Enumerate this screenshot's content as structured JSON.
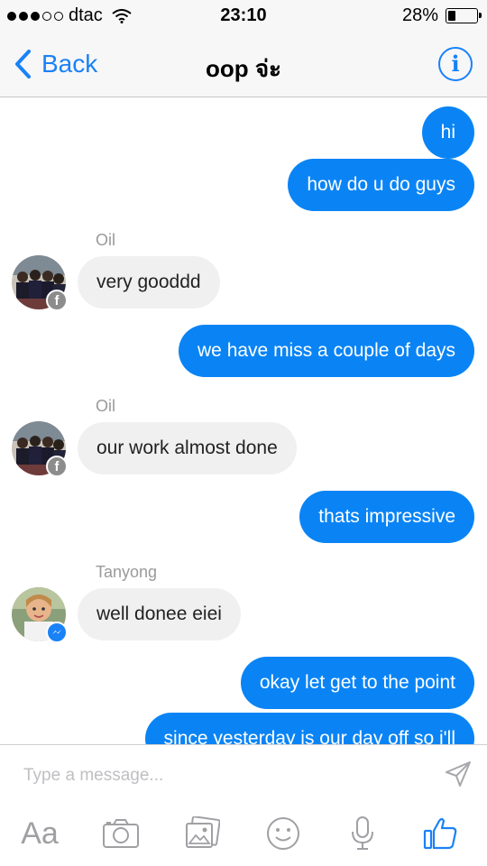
{
  "status_bar": {
    "carrier": "dtac",
    "time": "23:10",
    "battery_percent": "28%",
    "battery_level": 0.28,
    "signal_bars": 3,
    "signal_total": 5
  },
  "nav": {
    "back_label": "Back",
    "title": "oop จ่ะ",
    "info_icon": "info-icon"
  },
  "messages": [
    {
      "side": "out",
      "text": "hi"
    },
    {
      "side": "out",
      "text": "how do u do guys"
    },
    {
      "side": "in",
      "sender": "Oil",
      "text": "very gooddd",
      "badge": "facebook"
    },
    {
      "side": "out",
      "text": "we have miss a couple of days"
    },
    {
      "side": "in",
      "sender": "Oil",
      "text": "our work almost done",
      "badge": "facebook"
    },
    {
      "side": "out",
      "text": "thats impressive"
    },
    {
      "side": "in",
      "sender": "Tanyong",
      "text": "well donee eiei",
      "badge": "messenger"
    },
    {
      "side": "out",
      "text": "okay let get to the point"
    },
    {
      "side": "out",
      "text": "since yesterday is our day off so i'll"
    }
  ],
  "compose": {
    "placeholder": "Type a message...",
    "toolbar": [
      "text-format-icon",
      "camera-icon",
      "photo-gallery-icon",
      "emoji-icon",
      "microphone-icon",
      "like-icon"
    ],
    "aa_label": "Aa"
  },
  "colors": {
    "accent": "#1a82f7",
    "outgoing_bubble": "#0a84f5",
    "incoming_bubble": "#f0f0f0"
  }
}
